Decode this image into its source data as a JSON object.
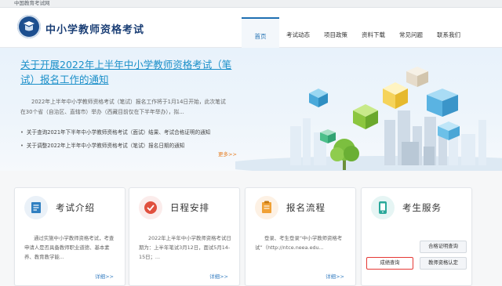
{
  "top_bar": {
    "text": "中国教育考试网"
  },
  "header": {
    "title": "中小学教师资格考试"
  },
  "nav": [
    {
      "label": "首页",
      "active": true
    },
    {
      "label": "考试动态"
    },
    {
      "label": "项目政策"
    },
    {
      "label": "资料下载"
    },
    {
      "label": "常见问题"
    },
    {
      "label": "联系我们"
    }
  ],
  "hero": {
    "title": "关于开展2022年上半年中小学教师资格考试（笔试）报名工作的通知",
    "description": "2022年上半年中小学教师资格考试（笔试）报名工作将于1月14日开始，此次笔试在30个省（自治区、直辖市）举办（西藏目前仅在下半年举办），拟...",
    "links": [
      "关于查询2021年下半年中小学教师资格考试（面试）结果、考试合格证明的通知",
      "关于调整2022年上半年中小学教师资格考试（笔试）报名日期的通知"
    ],
    "more": "更多>>"
  },
  "cards": [
    {
      "title": "考试介绍",
      "icon": "document-icon",
      "body": "通过实施中小学教师资格考试，考查申请人是否具备教师职业道德、基本素养、教育教学能...",
      "more": "详细>>"
    },
    {
      "title": "日程安排",
      "icon": "checkmark-icon",
      "body": "2022年上半年中小学教师资格考试日期为：上半年笔试3月12日，面试5月14-15日；...",
      "more": "详细>>"
    },
    {
      "title": "报名流程",
      "icon": "notepad-icon",
      "body": "登录、考生登录“中小学教师资格考试”（http://ntce.neea.edu...",
      "more": "详细>>"
    },
    {
      "title": "考生服务",
      "icon": "phone-icon"
    }
  ],
  "services": {
    "btn_top_right": "合格证明查询",
    "btn_score": "成绩查询",
    "btn_cert": "教师资格认定"
  },
  "colors": {
    "brand": "#1a3e75",
    "accent": "#1a8fc9",
    "highlight_border": "#e53935"
  }
}
